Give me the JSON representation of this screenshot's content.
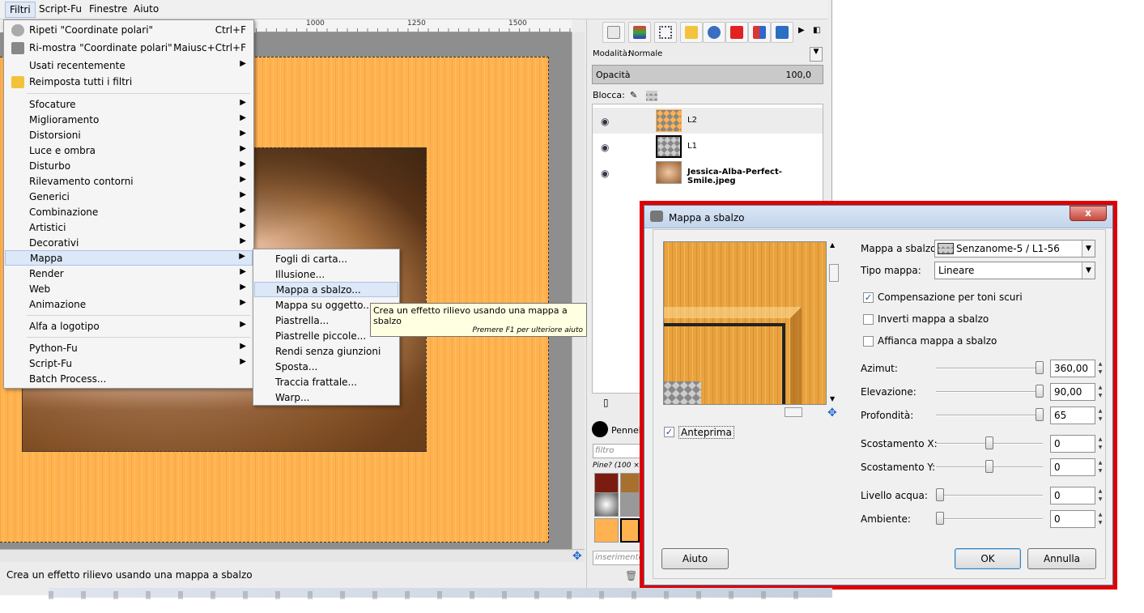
{
  "menubar": {
    "items": [
      "Filtri",
      "Script-Fu",
      "Finestre",
      "Aiuto"
    ]
  },
  "ruler": {
    "labels": [
      "1000",
      "1250",
      "1500"
    ]
  },
  "statusbar": {
    "text": "Crea un effetto rilievo usando una mappa a sbalzo"
  },
  "dock": {
    "mode_label": "Modalità:",
    "mode_value": "Normale",
    "opacity_label": "Opacità",
    "opacity_value": "100,0",
    "lock_label": "Blocca:",
    "layers": [
      {
        "name": "L2"
      },
      {
        "name": "L1"
      },
      {
        "name": "Jessica-Alba-Perfect-Smile.jpeg"
      }
    ],
    "brushes_label": "Pennelli",
    "brushes_filter_placeholder": "filtro",
    "brush_name": "Pine? (100 ×",
    "brush_tag_placeholder": "inserimento"
  },
  "filters_menu": {
    "repeat": {
      "label": "Ripeti \"Coordinate polari\"",
      "accel": "Ctrl+F"
    },
    "reshow": {
      "label": "Ri-mostra \"Coordinate polari\"",
      "accel": "Maiusc+Ctrl+F"
    },
    "recent": "Usati recentemente",
    "reset": "Reimposta tutti i filtri",
    "groups": [
      "Sfocature",
      "Miglioramento",
      "Distorsioni",
      "Luce e ombra",
      "Disturbo",
      "Rilevamento contorni",
      "Generici",
      "Combinazione",
      "Artistici",
      "Decorativi",
      "Mappa",
      "Render",
      "Web",
      "Animazione"
    ],
    "alpha": "Alfa a logotipo",
    "python": "Python-Fu",
    "script": "Script-Fu",
    "batch": "Batch Process..."
  },
  "submenu_mappa": [
    "Fogli di carta...",
    "Illusione...",
    "Mappa a sbalzo...",
    "Mappa su oggetto...",
    "Piastrella...",
    "Piastrelle piccole...",
    "Rendi senza giunzioni",
    "Sposta...",
    "Traccia frattale...",
    "Warp..."
  ],
  "tooltip": {
    "text": "Crea un effetto rilievo usando una mappa a sbalzo",
    "help": "Premere F1 per ulteriore aiuto"
  },
  "dialog": {
    "title": "Mappa a sbalzo",
    "close": "x",
    "preview_label": "Anteprima",
    "bump_map_label": "Mappa a sbalzo:",
    "bump_map_value": "Senzanome-5 / L1-56",
    "map_type_label": "Tipo mappa:",
    "map_type_value": "Lineare",
    "cb_compensate": "Compensazione per toni scuri",
    "cb_invert": "Inverti mappa a sbalzo",
    "cb_tile": "Affianca mappa a sbalzo",
    "azimuth_label": "Azimut:",
    "azimuth_value": "360,00",
    "elevation_label": "Elevazione:",
    "elevation_value": "90,00",
    "depth_label": "Profondità:",
    "depth_value": "65",
    "offset_x_label": "Scostamento X:",
    "offset_x_value": "0",
    "offset_y_label": "Scostamento Y:",
    "offset_y_value": "0",
    "water_label": "Livello acqua:",
    "water_value": "0",
    "ambient_label": "Ambiente:",
    "ambient_value": "0",
    "help_btn": "Aiuto",
    "ok_btn": "OK",
    "cancel_btn": "Annulla"
  },
  "colors": {
    "highlight_red": "#e00000",
    "wood": "#ffb24f",
    "menu_highlight": "#dce7f7"
  }
}
